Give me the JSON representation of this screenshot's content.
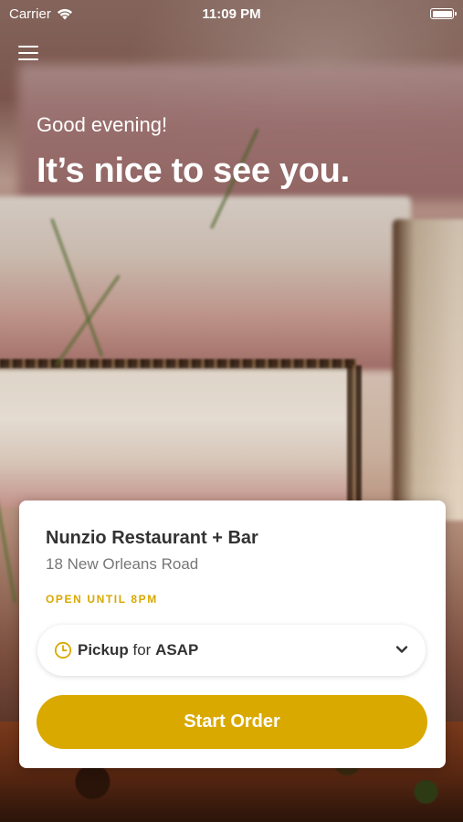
{
  "status_bar": {
    "carrier": "Carrier",
    "time": "11:09 PM"
  },
  "icons": {
    "menu": "menu-icon",
    "wifi": "wifi-icon",
    "battery": "battery-icon",
    "clock": "clock-icon",
    "chevron": "chevron-down-icon"
  },
  "hero": {
    "greeting": "Good evening!",
    "headline": "It’s nice to see you."
  },
  "restaurant": {
    "name": "Nunzio Restaurant + Bar",
    "address": "18 New Orleans Road",
    "hours": "OPEN UNTIL 8PM"
  },
  "order": {
    "type": "Pickup",
    "connector": "for",
    "time": "ASAP",
    "start_label": "Start Order"
  },
  "colors": {
    "accent": "#d9a900",
    "hours_text": "#d8a800"
  }
}
